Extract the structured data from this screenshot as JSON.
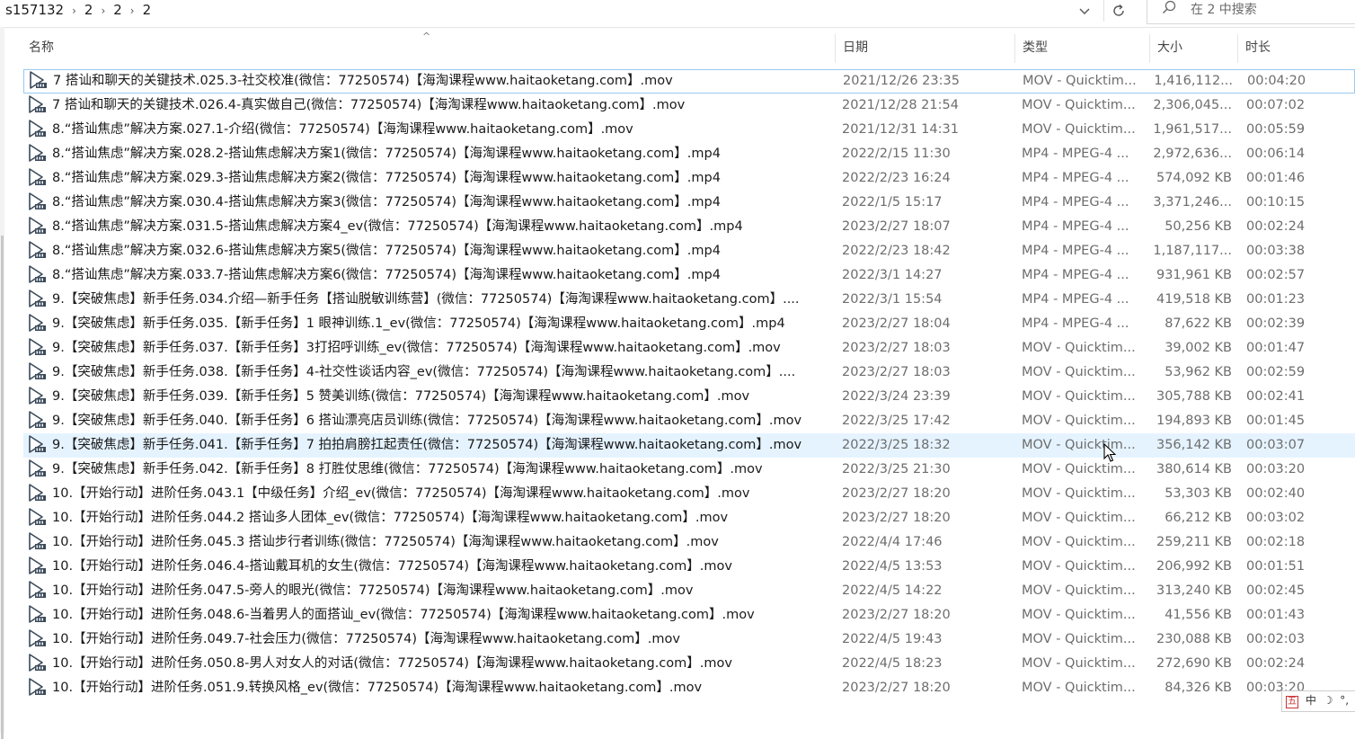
{
  "breadcrumb": [
    "s157132",
    "2",
    "2",
    "2"
  ],
  "search": {
    "placeholder": "在 2 中搜索"
  },
  "columns": {
    "name": "名称",
    "date": "日期",
    "type": "类型",
    "size": "大小",
    "duration": "时长"
  },
  "files": [
    {
      "name": "7 搭讪和聊天的关键技术.025.3-社交校准(微信：77250574)【海淘课程www.haitaoketang.com】.mov",
      "date": "2021/12/26 23:35",
      "type": "MOV - Quicktim...",
      "size": "1,416,112...",
      "duration": "00:04:20"
    },
    {
      "name": "7 搭讪和聊天的关键技术.026.4-真实做自己(微信：77250574)【海淘课程www.haitaoketang.com】.mov",
      "date": "2021/12/28 21:54",
      "type": "MOV - Quicktim...",
      "size": "2,306,045...",
      "duration": "00:07:02"
    },
    {
      "name": "8.“搭讪焦虑”解决方案.027.1-介绍(微信：77250574)【海淘课程www.haitaoketang.com】.mov",
      "date": "2021/12/31 14:31",
      "type": "MOV - Quicktim...",
      "size": "1,961,517...",
      "duration": "00:05:59"
    },
    {
      "name": "8.“搭讪焦虑”解决方案.028.2-搭讪焦虑解决方案1(微信：77250574)【海淘课程www.haitaoketang.com】.mp4",
      "date": "2022/2/15 11:30",
      "type": "MP4 - MPEG-4 ...",
      "size": "2,972,636...",
      "duration": "00:06:14"
    },
    {
      "name": "8.“搭讪焦虑”解决方案.029.3-搭讪焦虑解决方案2(微信：77250574)【海淘课程www.haitaoketang.com】.mp4",
      "date": "2022/2/23 16:24",
      "type": "MP4 - MPEG-4 ...",
      "size": "574,092 KB",
      "duration": "00:01:46"
    },
    {
      "name": "8.“搭讪焦虑”解决方案.030.4-搭讪焦虑解决方案3(微信：77250574)【海淘课程www.haitaoketang.com】.mp4",
      "date": "2022/1/5 15:17",
      "type": "MP4 - MPEG-4 ...",
      "size": "3,371,246...",
      "duration": "00:10:15"
    },
    {
      "name": "8.“搭讪焦虑”解决方案.031.5-搭讪焦虑解决方案4_ev(微信：77250574)【海淘课程www.haitaoketang.com】.mp4",
      "date": "2023/2/27 18:07",
      "type": "MP4 - MPEG-4 ...",
      "size": "50,256 KB",
      "duration": "00:02:24"
    },
    {
      "name": "8.“搭讪焦虑”解决方案.032.6-搭讪焦虑解决方案5(微信：77250574)【海淘课程www.haitaoketang.com】.mp4",
      "date": "2022/2/23 18:42",
      "type": "MP4 - MPEG-4 ...",
      "size": "1,187,117...",
      "duration": "00:03:38"
    },
    {
      "name": "8.“搭讪焦虑”解决方案.033.7-搭讪焦虑解决方案6(微信：77250574)【海淘课程www.haitaoketang.com】.mp4",
      "date": "2022/3/1 14:27",
      "type": "MP4 - MPEG-4 ...",
      "size": "931,961 KB",
      "duration": "00:02:57"
    },
    {
      "name": "9.【突破焦虑】新手任务.034.介绍—新手任务【搭讪脱敏训练营】(微信：77250574)【海淘课程www.haitaoketang.com】....",
      "date": "2022/3/1 15:54",
      "type": "MP4 - MPEG-4 ...",
      "size": "419,518 KB",
      "duration": "00:01:23"
    },
    {
      "name": "9.【突破焦虑】新手任务.035.【新手任务】1 眼神训练.1_ev(微信：77250574)【海淘课程www.haitaoketang.com】.mp4",
      "date": "2023/2/27 18:04",
      "type": "MP4 - MPEG-4 ...",
      "size": "87,622 KB",
      "duration": "00:02:39"
    },
    {
      "name": "9.【突破焦虑】新手任务.037.【新手任务】3打招呼训练_ev(微信：77250574)【海淘课程www.haitaoketang.com】.mov",
      "date": "2023/2/27 18:03",
      "type": "MOV - Quicktim...",
      "size": "39,002 KB",
      "duration": "00:01:47"
    },
    {
      "name": "9.【突破焦虑】新手任务.038.【新手任务】4-社交性谈话内容_ev(微信：77250574)【海淘课程www.haitaoketang.com】....",
      "date": "2023/2/27 18:03",
      "type": "MOV - Quicktim...",
      "size": "53,962 KB",
      "duration": "00:02:59"
    },
    {
      "name": "9.【突破焦虑】新手任务.039.【新手任务】5 赞美训练(微信：77250574)【海淘课程www.haitaoketang.com】.mov",
      "date": "2022/3/24 23:39",
      "type": "MOV - Quicktim...",
      "size": "305,788 KB",
      "duration": "00:02:41"
    },
    {
      "name": "9.【突破焦虑】新手任务.040.【新手任务】6 搭讪漂亮店员训练(微信：77250574)【海淘课程www.haitaoketang.com】.mov",
      "date": "2022/3/25 17:42",
      "type": "MOV - Quicktim...",
      "size": "194,893 KB",
      "duration": "00:01:45"
    },
    {
      "name": "9.【突破焦虑】新手任务.041.【新手任务】7 拍拍肩膀扛起责任(微信：77250574)【海淘课程www.haitaoketang.com】.mov",
      "date": "2022/3/25 18:32",
      "type": "MOV - Quicktim...",
      "size": "356,142 KB",
      "duration": "00:03:07"
    },
    {
      "name": "9.【突破焦虑】新手任务.042.【新手任务】8 打胜仗思维(微信：77250574)【海淘课程www.haitaoketang.com】.mov",
      "date": "2022/3/25 21:30",
      "type": "MOV - Quicktim...",
      "size": "380,614 KB",
      "duration": "00:03:20"
    },
    {
      "name": "10.【开始行动】进阶任务.043.1【中级任务】介绍_ev(微信：77250574)【海淘课程www.haitaoketang.com】.mov",
      "date": "2023/2/27 18:20",
      "type": "MOV - Quicktim...",
      "size": "53,303 KB",
      "duration": "00:02:40"
    },
    {
      "name": "10.【开始行动】进阶任务.044.2 搭讪多人团体_ev(微信：77250574)【海淘课程www.haitaoketang.com】.mov",
      "date": "2023/2/27 18:20",
      "type": "MOV - Quicktim...",
      "size": "66,212 KB",
      "duration": "00:03:02"
    },
    {
      "name": "10.【开始行动】进阶任务.045.3 搭讪步行者训练(微信：77250574)【海淘课程www.haitaoketang.com】.mov",
      "date": "2022/4/4 17:46",
      "type": "MOV - Quicktim...",
      "size": "259,211 KB",
      "duration": "00:02:18"
    },
    {
      "name": "10.【开始行动】进阶任务.046.4-搭讪戴耳机的女生(微信：77250574)【海淘课程www.haitaoketang.com】.mov",
      "date": "2022/4/5 13:53",
      "type": "MOV - Quicktim...",
      "size": "206,992 KB",
      "duration": "00:01:51"
    },
    {
      "name": "10.【开始行动】进阶任务.047.5-旁人的眼光(微信：77250574)【海淘课程www.haitaoketang.com】.mov",
      "date": "2022/4/5 14:22",
      "type": "MOV - Quicktim...",
      "size": "313,240 KB",
      "duration": "00:02:45"
    },
    {
      "name": "10.【开始行动】进阶任务.048.6-当着男人的面搭讪_ev(微信：77250574)【海淘课程www.haitaoketang.com】.mov",
      "date": "2023/2/27 18:20",
      "type": "MOV - Quicktim...",
      "size": "41,556 KB",
      "duration": "00:01:43"
    },
    {
      "name": "10.【开始行动】进阶任务.049.7-社会压力(微信：77250574)【海淘课程www.haitaoketang.com】.mov",
      "date": "2022/4/5 19:43",
      "type": "MOV - Quicktim...",
      "size": "230,088 KB",
      "duration": "00:02:03"
    },
    {
      "name": "10.【开始行动】进阶任务.050.8-男人对女人的对话(微信：77250574)【海淘课程www.haitaoketang.com】.mov",
      "date": "2022/4/5 18:23",
      "type": "MOV - Quicktim...",
      "size": "272,690 KB",
      "duration": "00:02:24"
    },
    {
      "name": "10.【开始行动】进阶任务.051.9.转换风格_ev(微信：77250574)【海淘课程www.haitaoketang.com】.mov",
      "date": "2023/2/27 18:20",
      "type": "MOV - Quicktim...",
      "size": "84,326 KB",
      "duration": "00:03:20"
    }
  ],
  "ime": {
    "labels": [
      "中"
    ]
  },
  "colors": {
    "focus_border": "#99c9ef",
    "hover_bg": "#e5f3ff",
    "secondary_text": "#6d6d6d"
  },
  "icons": {
    "file": "video-file-icon",
    "search": "search-icon",
    "refresh": "refresh-icon",
    "dropdown": "chevron-down-icon"
  }
}
